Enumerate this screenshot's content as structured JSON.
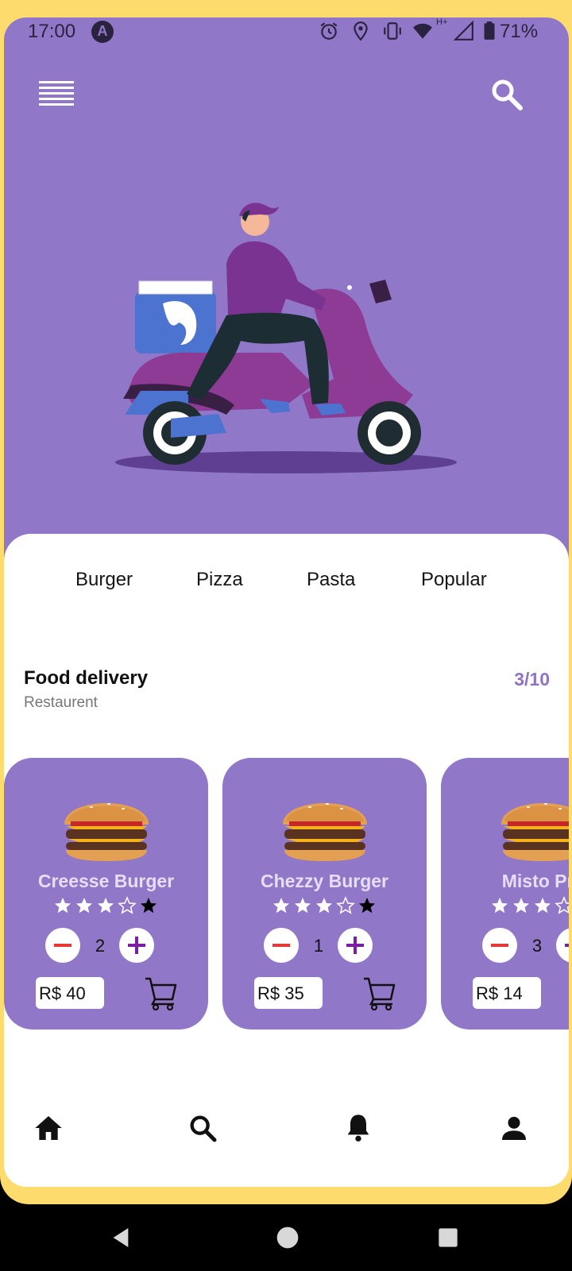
{
  "status_bar": {
    "time": "17:00",
    "notification_icon": "A",
    "network_label": "H+",
    "battery_percent": "71%",
    "icons": [
      "alarm-icon",
      "location-icon",
      "vibrate-icon",
      "wifi-icon",
      "signal-icon",
      "battery-icon"
    ]
  },
  "header": {
    "menu_icon": "menu-icon",
    "search_icon": "search-icon"
  },
  "categories": [
    "Burger",
    "Pizza",
    "Pasta",
    "Popular"
  ],
  "section": {
    "title": "Food delivery",
    "subtitle": "Restaurent",
    "counter": "3/10"
  },
  "products": [
    {
      "name": "Creesse Burger",
      "rating": 3.5,
      "quantity": "2",
      "price": "R$ 40"
    },
    {
      "name": "Chezzy Burger",
      "rating": 3.5,
      "quantity": "1",
      "price": "R$ 35"
    },
    {
      "name": "Misto Pre",
      "rating": 3.5,
      "quantity": "3",
      "price": "R$ 14"
    }
  ],
  "bottom_nav": [
    "home-icon",
    "search-icon",
    "bell-icon",
    "user-icon"
  ],
  "system_nav": [
    "back-icon",
    "home-circle-icon",
    "recents-icon"
  ],
  "colors": {
    "accent": "#9177C7",
    "frame": "#FDDB6D",
    "minus": "#E53935",
    "plus": "#7B1FA2"
  }
}
